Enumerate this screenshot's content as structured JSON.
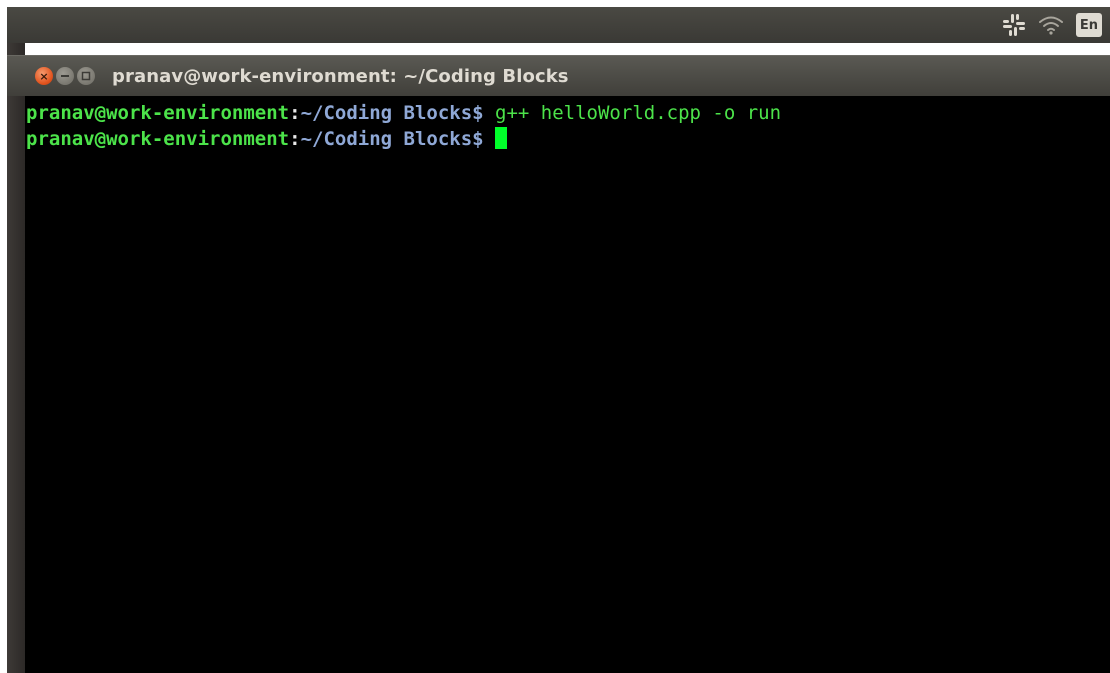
{
  "top_panel": {
    "indicators": [
      {
        "icon": "slack-icon"
      },
      {
        "icon": "wifi-icon"
      }
    ],
    "language": "En"
  },
  "window": {
    "title": "pranav@work-environment: ~/Coding Blocks",
    "buttons": {
      "close": "×",
      "minimize_icon": "minimize-icon",
      "maximize_icon": "maximize-icon"
    }
  },
  "terminal": {
    "lines": [
      {
        "user_host": "pranav@work-environment",
        "colon": ":",
        "path": "~/Coding Blocks",
        "dollar": "$ ",
        "command": "g++ helloWorld.cpp -o run"
      },
      {
        "user_host": "pranav@work-environment",
        "colon": ":",
        "path": "~/Coding Blocks",
        "dollar": "$ ",
        "command": ""
      }
    ]
  },
  "colors": {
    "prompt_user": "#4ce34a",
    "prompt_path": "#8fa8d6",
    "cursor": "#00ff2a",
    "terminal_bg": "#000000",
    "panel_bg": "#3c3b37",
    "close_button": "#e2531d"
  }
}
